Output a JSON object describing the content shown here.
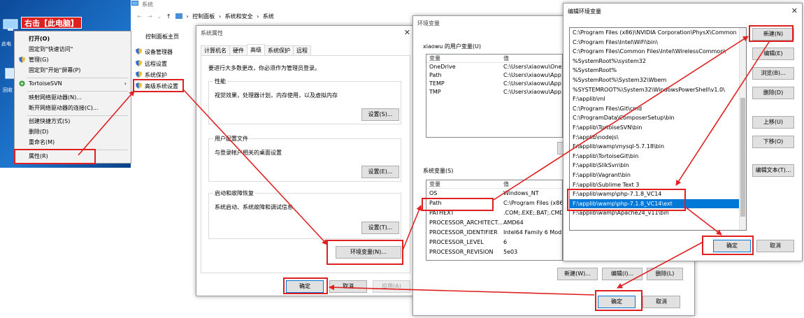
{
  "desktop": {
    "annotation": "右击【此电脑】",
    "icon_labels": [
      "此电",
      "回收"
    ]
  },
  "context_menu": {
    "items": [
      {
        "label": "打开(O)",
        "bold": true
      },
      {
        "label": "固定到\"快速访问\""
      },
      {
        "label": "管理(G)",
        "icon": "shield-icon"
      },
      {
        "label": "固定到\"开始\"屏幕(P)"
      },
      {
        "label": "TortoiseSVN",
        "icon": "tortoise-svn-icon",
        "submenu": true
      },
      {
        "label": "映射网络驱动器(N)..."
      },
      {
        "label": "断开网络驱动器的连接(C)..."
      },
      {
        "label": "创建快捷方式(S)"
      },
      {
        "label": "删除(D)"
      },
      {
        "label": "重命名(M)"
      },
      {
        "label": "属性(R)"
      }
    ],
    "submenu_arrow": "›"
  },
  "system_window": {
    "title": "系统",
    "breadcrumb": [
      "控制面板",
      "系统和安全",
      "系统"
    ],
    "nav_up": "↑",
    "sidebar_home": "控制面板主页",
    "links": [
      "设备管理器",
      "远程设置",
      "系统保护",
      "高级系统设置"
    ]
  },
  "sys_props": {
    "title": "系统属性",
    "close": "✕",
    "tabs": [
      "计算机名",
      "硬件",
      "高级",
      "系统保护",
      "远程"
    ],
    "intro": "要进行大多数更改，你必须作为管理员登录。",
    "perf_label": "性能",
    "perf_desc": "视觉效果，处理器计划，内存使用，以及虚拟内存",
    "perf_btn": "设置(S)...",
    "profile_label": "用户配置文件",
    "profile_desc": "与登录帐户相关的桌面设置",
    "profile_btn": "设置(E)...",
    "startup_label": "启动和故障恢复",
    "startup_desc": "系统启动、系统故障和调试信息",
    "startup_btn": "设置(T)...",
    "env_btn": "环境变量(N)...",
    "ok": "确定",
    "cancel": "取消",
    "apply": "应用(A)"
  },
  "env_vars": {
    "title": "环境变量",
    "user_label": "xiaowu 的用户变量(U)",
    "col_var": "变量",
    "col_val": "值",
    "user_vars": [
      {
        "name": "OneDrive",
        "value": "C:\\Users\\xiaowu\\One"
      },
      {
        "name": "Path",
        "value": "C:\\Users\\xiaowu\\App"
      },
      {
        "name": "TEMP",
        "value": "C:\\Users\\xiaowu\\App"
      },
      {
        "name": "TMP",
        "value": "C:\\Users\\xiaowu\\App"
      }
    ],
    "sys_label": "系统变量(S)",
    "sys_vars": [
      {
        "name": "OS",
        "value": "Windows_NT"
      },
      {
        "name": "Path",
        "value": "C:\\Program Files (x86"
      },
      {
        "name": "PATHEXT",
        "value": ".COM;.EXE;.BAT;.CMD"
      },
      {
        "name": "PROCESSOR_ARCHITECT...",
        "value": "AMD64"
      },
      {
        "name": "PROCESSOR_IDENTIFIER",
        "value": "Intel64 Family 6 Mod"
      },
      {
        "name": "PROCESSOR_LEVEL",
        "value": "6"
      },
      {
        "name": "PROCESSOR_REVISION",
        "value": "5e03"
      }
    ],
    "btn_new": "新建(W)...",
    "btn_edit": "编辑(I)...",
    "btn_delete": "删除(L)",
    "ok": "确定",
    "cancel": "取消"
  },
  "edit_env": {
    "title": "编辑环境变量",
    "close": "✕",
    "entries": [
      "C:\\Program Files (x86)\\NVIDIA Corporation\\PhysX\\Common",
      "C:\\Program Files\\Intel\\WiFi\\bin\\",
      "C:\\Program Files\\Common Files\\Intel\\WirelessCommon\\",
      "%SystemRoot%\\system32",
      "%SystemRoot%",
      "%SystemRoot%\\System32\\Wbem",
      "%SYSTEMROOT%\\System32\\WindowsPowerShell\\v1.0\\",
      "F:\\applib\\ml",
      "C:\\Program Files\\Git\\cmd",
      "C:\\ProgramData\\ComposerSetup\\bin",
      "F:\\applib\\TortoiseSVN\\bin",
      "F:\\applib\\nodejs\\",
      "F:\\applib\\wamp\\mysql-5.7.18\\bin",
      "F:\\applib\\TortoiseGit\\bin",
      "F:\\applib\\SlikSvn\\bin",
      "F:\\applib\\Vagrant\\bin",
      "F:\\applib\\Sublime Text 3",
      "F:\\applib\\wamp\\php-7.1.8_VC14",
      "F:\\applib\\wamp\\php-7.1.8_VC14\\ext",
      "F:\\applib\\wamp\\Apache24_v11\\bin"
    ],
    "selected_index": 18,
    "btn_new": "新建(N)",
    "btn_edit": "编辑(E)",
    "btn_browse": "浏览(B)...",
    "btn_delete": "删除(D)",
    "btn_up": "上移(U)",
    "btn_down": "下移(O)",
    "btn_edit_text": "编辑文本(T)...",
    "ok": "确定",
    "cancel": "取消"
  },
  "colors": {
    "annotation_red": "#e02020",
    "desktop_blue": "#1567c2",
    "selection_blue": "#0078d7"
  }
}
